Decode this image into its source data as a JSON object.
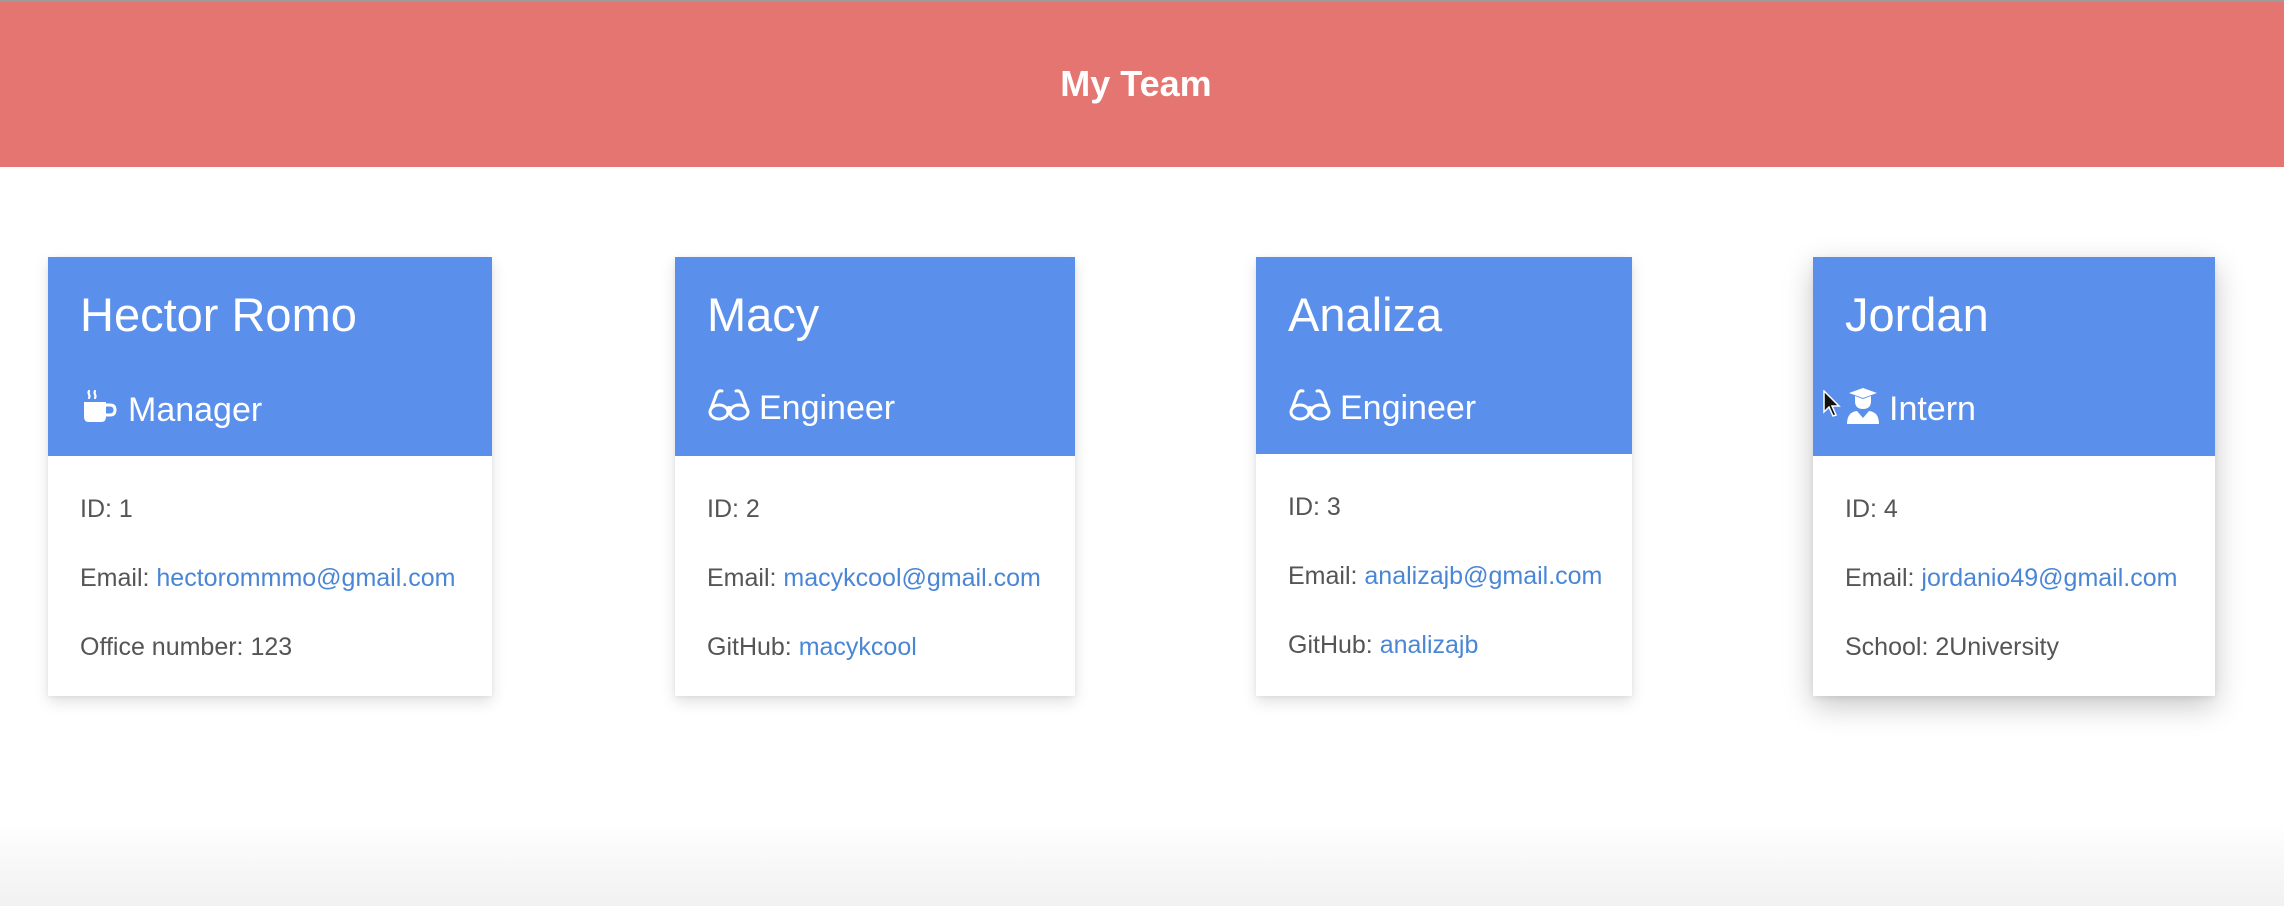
{
  "header": {
    "title": "My Team"
  },
  "cards": [
    {
      "name": "Hector Romo",
      "role": "Manager",
      "role_icon": "coffee-mug-icon",
      "id_label": "ID: ",
      "id_value": "1",
      "email_label": "Email: ",
      "email": "hectorommmo@gmail.com",
      "extra_label": "Office number: ",
      "extra_value": "123"
    },
    {
      "name": "Macy",
      "role": "Engineer",
      "role_icon": "glasses-icon",
      "id_label": "ID: ",
      "id_value": "2",
      "email_label": "Email: ",
      "email": "macykcool@gmail.com",
      "extra_label": "GitHub: ",
      "extra_value": "macykcool"
    },
    {
      "name": "Analiza",
      "role": "Engineer",
      "role_icon": "glasses-icon",
      "id_label": "ID: ",
      "id_value": "3",
      "email_label": "Email: ",
      "email": "analizajb@gmail.com",
      "extra_label": "GitHub: ",
      "extra_value": "analizajb"
    },
    {
      "name": "Jordan",
      "role": "Intern",
      "role_icon": "graduate-icon",
      "id_label": "ID: ",
      "id_value": "4",
      "email_label": "Email: ",
      "email": "jordanio49@gmail.com",
      "extra_label": "School: ",
      "extra_value": "2University"
    }
  ],
  "colors": {
    "header_bg": "#e57571",
    "card_head_bg": "#5a8feb",
    "link": "#4a86d6",
    "body_text": "#555555"
  }
}
